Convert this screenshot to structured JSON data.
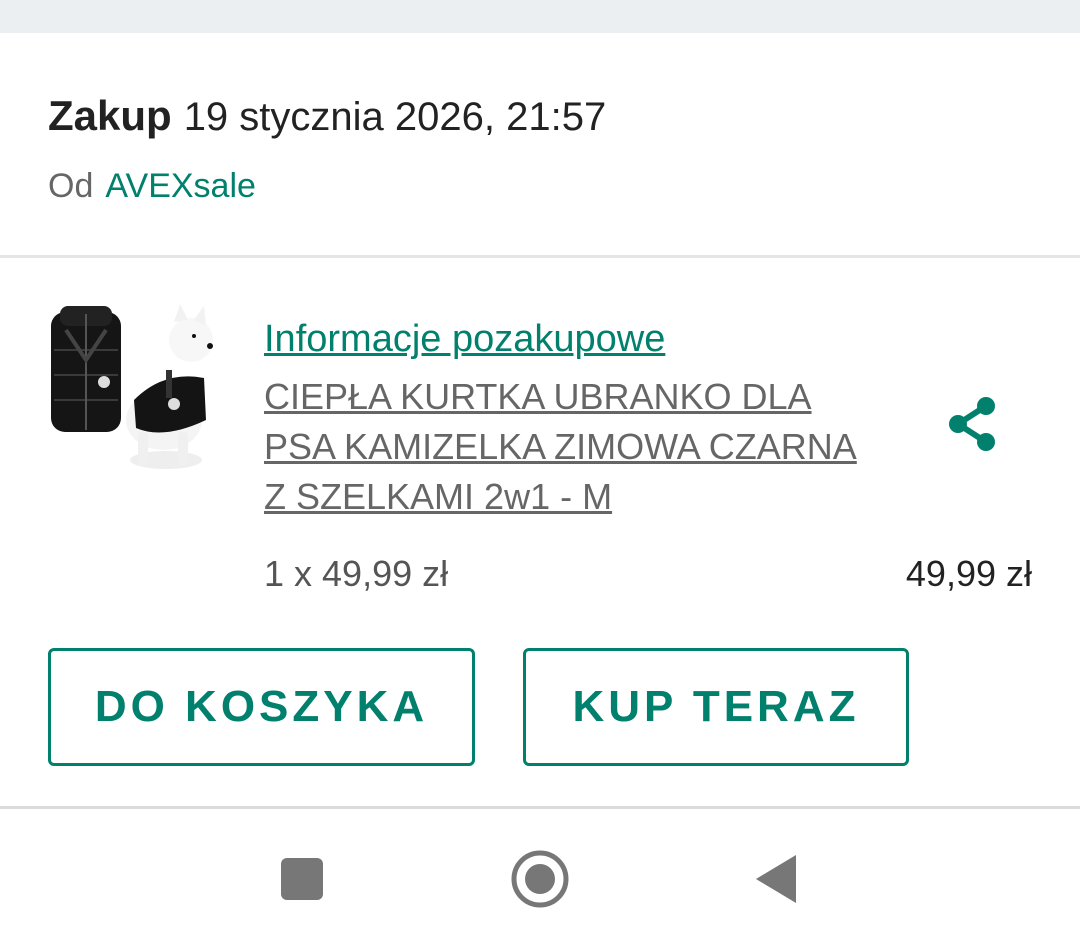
{
  "header": {
    "purchase_label": "Zakup",
    "purchase_date": "19 stycznia 2026, 21:57",
    "seller_prefix": "Od",
    "seller_name": "AVEXsale"
  },
  "product": {
    "image_icon": "dog-jacket-product-image",
    "after_purchase_link": "Informacje pozakupowe",
    "title": "CIEPŁA KURTKA UBRANKO DLA PSA KAMIZELKA ZIMOWA CZARNA Z SZELKAMI 2w1 - M",
    "quantity_price": "1 x 49,99 zł",
    "total_price": "49,99 zł",
    "share_icon": "share-icon"
  },
  "actions": {
    "add_to_cart": "DO KOSZYKA",
    "buy_now": "KUP TERAZ"
  },
  "navbar": {
    "recents_icon": "square-recents-icon",
    "home_icon": "circle-home-icon",
    "back_icon": "triangle-back-icon"
  },
  "colors": {
    "accent": "#00806d",
    "text_primary": "#222222",
    "text_secondary": "#666666",
    "divider": "#e4e6e6",
    "topbar": "#eceff1"
  }
}
